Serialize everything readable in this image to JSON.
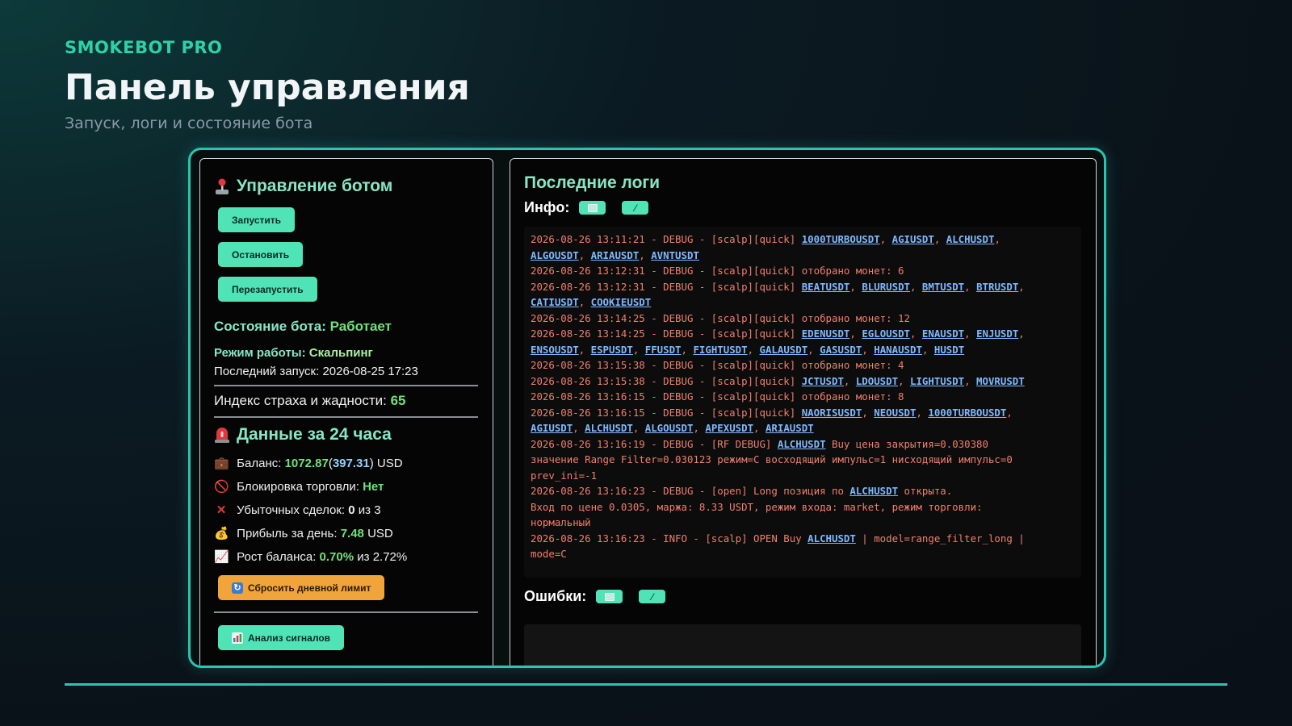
{
  "header": {
    "brand": "SMOKEBOT PRO",
    "title": "Панель управления",
    "subtitle": "Запуск, логи и состояние бота"
  },
  "control": {
    "title": "Управление ботом",
    "start": "Запустить",
    "stop": "Остановить",
    "restart": "Перезапустить",
    "state_label": "Состояние бота:",
    "state_value": "Работает",
    "mode_label": "Режим работы:",
    "mode_value": "Скальпинг",
    "last_start_label": "Последний запуск:",
    "last_start_value": "2026-08-25 17:23",
    "fear_label": "Индекс страха и жадности:",
    "fear_value": "65"
  },
  "daily": {
    "title": "Данные за 24 часа",
    "balance_label": "Баланс:",
    "balance_value": "1072.87",
    "balance_paren_open": "(",
    "balance_sub": "397.31",
    "balance_unit": ") USD",
    "lock_label": "Блокировка торговли:",
    "lock_value": "Нет",
    "losses_label": "Убыточных сделок:",
    "losses_value": "0",
    "losses_total": "из 3",
    "profit_label": "Прибыль за день:",
    "profit_value": "7.48",
    "profit_unit": "USD",
    "growth_label": "Рост баланса:",
    "growth_value": "0.70%",
    "growth_total": "из 2.72%",
    "reset_button": "Сбросить дневной лимит",
    "signals_button": "Анализ сигналов"
  },
  "logs": {
    "title": "Последние логи",
    "info_label": "Инфо:",
    "errors_label": "Ошибки:",
    "lines": [
      [
        {
          "t": "2026-08-26 13:11:21 - DEBUG - [scalp][quick] "
        },
        {
          "t": "1000TURBOUSDT",
          "s": 1
        },
        {
          "t": ", "
        },
        {
          "t": "AGIUSDT",
          "s": 1
        },
        {
          "t": ", "
        },
        {
          "t": "ALCHUSDT",
          "s": 1
        },
        {
          "t": ",\n"
        },
        {
          "t": "ALGOUSDT",
          "s": 1
        },
        {
          "t": ", "
        },
        {
          "t": "ARIAUSDT",
          "s": 1
        },
        {
          "t": ", "
        },
        {
          "t": "AVNTUSDT",
          "s": 1
        }
      ],
      [
        {
          "t": "2026-08-26 13:12:31 - DEBUG - [scalp][quick] отобрано монет: 6"
        }
      ],
      [
        {
          "t": "2026-08-26 13:12:31 - DEBUG - [scalp][quick] "
        },
        {
          "t": "BEATUSDT",
          "s": 1
        },
        {
          "t": ", "
        },
        {
          "t": "BLURUSDT",
          "s": 1
        },
        {
          "t": ", "
        },
        {
          "t": "BMTUSDT",
          "s": 1
        },
        {
          "t": ", "
        },
        {
          "t": "BTRUSDT",
          "s": 1
        },
        {
          "t": ",\n"
        },
        {
          "t": "CATIUSDT",
          "s": 1
        },
        {
          "t": ", "
        },
        {
          "t": "COOKIEUSDT",
          "s": 1
        }
      ],
      [
        {
          "t": "2026-08-26 13:14:25 - DEBUG - [scalp][quick] отобрано монет: 12"
        }
      ],
      [
        {
          "t": "2026-08-26 13:14:25 - DEBUG - [scalp][quick] "
        },
        {
          "t": "EDENUSDT",
          "s": 1
        },
        {
          "t": ", "
        },
        {
          "t": "EGLOUSDT",
          "s": 1
        },
        {
          "t": ", "
        },
        {
          "t": "ENAUSDT",
          "s": 1
        },
        {
          "t": ", "
        },
        {
          "t": "ENJUSDT",
          "s": 1
        },
        {
          "t": ",\n"
        },
        {
          "t": "ENSOUSDT",
          "s": 1
        },
        {
          "t": ", "
        },
        {
          "t": "ESPUSDT",
          "s": 1
        },
        {
          "t": ", "
        },
        {
          "t": "FFUSDT",
          "s": 1
        },
        {
          "t": ", "
        },
        {
          "t": "FIGHTUSDT",
          "s": 1
        },
        {
          "t": ", "
        },
        {
          "t": "GALAUSDT",
          "s": 1
        },
        {
          "t": ", "
        },
        {
          "t": "GASUSDT",
          "s": 1
        },
        {
          "t": ", "
        },
        {
          "t": "HANAUSDT",
          "s": 1
        },
        {
          "t": ", "
        },
        {
          "t": "HUSDT",
          "s": 1
        }
      ],
      [
        {
          "t": "2026-08-26 13:15:38 - DEBUG - [scalp][quick] отобрано монет: 4"
        }
      ],
      [
        {
          "t": "2026-08-26 13:15:38 - DEBUG - [scalp][quick] "
        },
        {
          "t": "JCTUSDT",
          "s": 1
        },
        {
          "t": ", "
        },
        {
          "t": "LDOUSDT",
          "s": 1
        },
        {
          "t": ", "
        },
        {
          "t": "LIGHTUSDT",
          "s": 1
        },
        {
          "t": ", "
        },
        {
          "t": "MOVRUSDT",
          "s": 1
        }
      ],
      [
        {
          "t": "2026-08-26 13:16:15 - DEBUG - [scalp][quick] отобрано монет: 8"
        }
      ],
      [
        {
          "t": "2026-08-26 13:16:15 - DEBUG - [scalp][quick] "
        },
        {
          "t": "NAORISUSDT",
          "s": 1
        },
        {
          "t": ", "
        },
        {
          "t": "NEOUSDT",
          "s": 1
        },
        {
          "t": ", "
        },
        {
          "t": "1000TURBOUSDT",
          "s": 1
        },
        {
          "t": ",\n"
        },
        {
          "t": "AGIUSDT",
          "s": 1
        },
        {
          "t": ", "
        },
        {
          "t": "ALCHUSDT",
          "s": 1
        },
        {
          "t": ", "
        },
        {
          "t": "ALGOUSDT",
          "s": 1
        },
        {
          "t": ", "
        },
        {
          "t": "APEXUSDT",
          "s": 1
        },
        {
          "t": ", "
        },
        {
          "t": "ARIAUSDT",
          "s": 1
        }
      ],
      [
        {
          "t": "2026-08-26 13:16:19 - DEBUG - [RF DEBUG] "
        },
        {
          "t": "ALCHUSDT",
          "s": 1
        },
        {
          "t": " Buy цена закрытия=0.030380\nзначение Range Filter=0.030123 режим=C восходящий импульс=1 нисходящий импульс=0\nprev_ini=-1"
        }
      ],
      [
        {
          "t": "2026-08-26 13:16:23 - DEBUG - [open] Long позиция по "
        },
        {
          "t": "ALCHUSDT",
          "s": 1
        },
        {
          "t": " открыта.\nВход по цене 0.0305, маржа: 8.33 USDT, режим входа: market, режим торговли:\nнормальный\n"
        }
      ],
      [
        {
          "t": "2026-08-26 13:16:23 - INFO - [scalp] OPEN Buy "
        },
        {
          "t": "ALCHUSDT",
          "s": 1
        },
        {
          "t": " | model=range_filter_long |\nmode=C"
        }
      ]
    ]
  },
  "icons": {
    "control": "joystick-icon",
    "daily": "siren-icon",
    "balance": "briefcase-icon",
    "lock": "prohibited-icon",
    "losses": "cross-mark-icon",
    "profit": "money-bag-icon",
    "growth": "chart-up-icon",
    "reset": "refresh-icon",
    "signals": "bar-chart-icon",
    "copy": "copy-icon",
    "clear": "broom-icon"
  },
  "colors": {
    "accent": "#2bc4b0",
    "button": "#4fe3b6",
    "button_orange": "#f0a43a",
    "log_text": "#f07f6e",
    "log_symbol": "#7fb8ff",
    "positive": "#6fe27a"
  }
}
